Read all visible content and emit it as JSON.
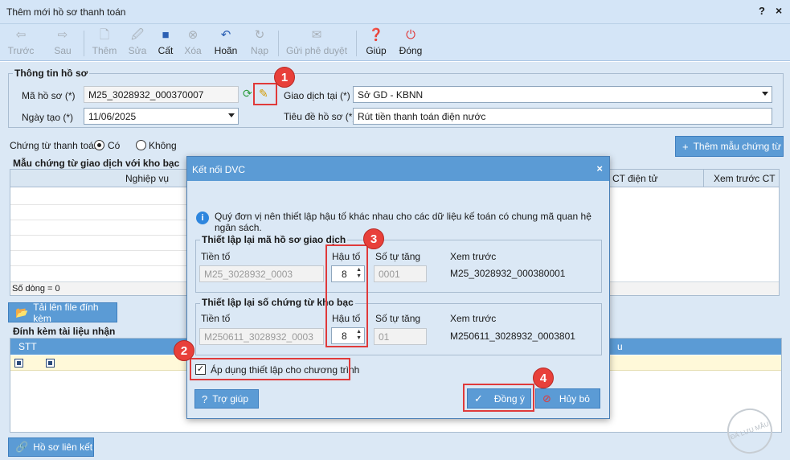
{
  "window": {
    "title": "Thêm mới hồ sơ thanh toán",
    "help_symbol": "?",
    "close_symbol": "×"
  },
  "toolbar": {
    "prev": "Trước",
    "next": "Sau",
    "add": "Thêm",
    "edit": "Sửa",
    "save": "Cất",
    "delete": "Xóa",
    "undo": "Hoãn",
    "load": "Nạp",
    "send_approval": "Gửi phê duyệt",
    "help": "Giúp",
    "close": "Đóng"
  },
  "profile_info": {
    "group_title": "Thông tin hồ sơ",
    "code_label": "Mã hồ sơ (*)",
    "code_value": "M25_3028932_000370007",
    "date_label": "Ngày tạo (*)",
    "date_value": "11/06/2025",
    "transaction_label": "Giao dịch tại (*)",
    "transaction_value": "Sở GD - KBNN",
    "title_label": "Tiêu đề hồ sơ (*)",
    "title_value": "Rút tiền thanh toán điện nước"
  },
  "payment_doc": {
    "label": "Chứng từ thanh toán:",
    "yes": "Có",
    "no": "Không",
    "add_template_button": "Thêm mẫu chứng từ",
    "plus": "+"
  },
  "template_grid": {
    "title": "Mẫu chứng từ giao dịch với kho bạc",
    "col_business": "Nghiệp vụ",
    "col_preview_e": "CT điện tử",
    "col_preview_ct": "Xem trước CT",
    "row_count": "Số dòng = 0"
  },
  "upload_button": "Tải lên file đính kèm",
  "attachments": {
    "title": "Đính kèm tài liệu nhận",
    "col_stt": "STT",
    "col_tail": "u"
  },
  "linked_button": "Hồ sơ liên kết",
  "dialog": {
    "title": "Kết nối DVC",
    "close_symbol": "×",
    "info_symbol": "i",
    "info_text": "Quý đơn vị nên thiết lập hậu tố khác nhau cho các dữ liệu kế toán có chung mã quan hệ ngân sách.",
    "group1": {
      "title": "Thiết lập lại mã hồ sơ giao dịch",
      "prefix_label": "Tiền tố",
      "prefix_value": "M25_3028932_0003",
      "suffix_label": "Hậu tố",
      "suffix_value": "8",
      "counter_label": "Số tự tăng",
      "counter_value": "0001",
      "preview_label": "Xem trước",
      "preview_value": "M25_3028932_000380001"
    },
    "group2": {
      "title": "Thiết lập lại số chứng từ kho bạc",
      "prefix_label": "Tiền tố",
      "prefix_value": "M250611_3028932_0003",
      "suffix_label": "Hậu tố",
      "suffix_value": "8",
      "counter_label": "Số tự tăng",
      "counter_value": "01",
      "preview_label": "Xem trước",
      "preview_value": "M250611_3028932_0003801"
    },
    "apply_checkbox_label": "Áp dụng thiết lập cho chương trình",
    "help_button": "Trợ giúp",
    "ok_button": "Đồng ý",
    "cancel_button": "Hủy bỏ"
  },
  "badges": [
    "1",
    "2",
    "3",
    "4"
  ],
  "watermark": "ĐÃ LƯU MẪU",
  "colors": {
    "accent": "#5b9bd5",
    "badge": "#e8403a",
    "highlight_box": "#e03a3a",
    "panel": "#dbe8f5"
  }
}
